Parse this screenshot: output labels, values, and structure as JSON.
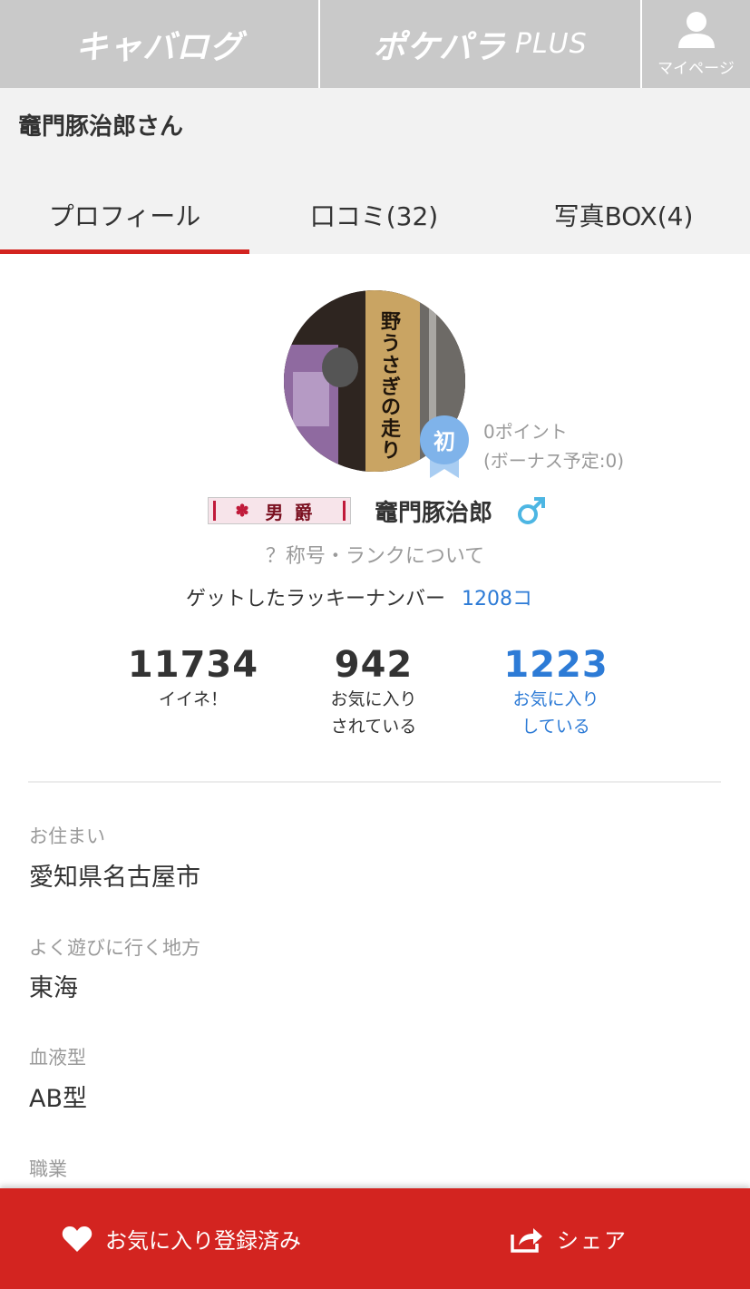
{
  "nav": {
    "logo1": "キャバログ",
    "logo2_main": "ポケパラ",
    "logo2_plus": "PLUS",
    "mypage": "マイページ"
  },
  "header": {
    "username": "竈門豚治郎さん",
    "tabs": [
      "プロフィール",
      "口コミ(32)",
      "写真BOX(4)"
    ],
    "active_tab_index": 0
  },
  "profile": {
    "avatar_label": "野うさぎの走り",
    "badge": "初",
    "points": "0ポイント",
    "bonus": "(ボーナス予定:0)",
    "rank": "男爵",
    "name": "竈門豚治郎",
    "gender_icon": "male-icon",
    "rank_link": "？称号・ランクについて",
    "lucky_label": "ゲットしたラッキーナンバー",
    "lucky_value": "1208コ"
  },
  "stats": [
    {
      "value": "11734",
      "label1": "イイネ！",
      "label2": ""
    },
    {
      "value": "942",
      "label1": "お気に入り",
      "label2": "されている"
    },
    {
      "value": "1223",
      "label1": "お気に入り",
      "label2": "している"
    }
  ],
  "fields": [
    {
      "label": "お住まい",
      "value": "愛知県名古屋市"
    },
    {
      "label": "よく遊びに行く地方",
      "value": "東海"
    },
    {
      "label": "血液型",
      "value": "AB型"
    },
    {
      "label": "職業",
      "value": ""
    }
  ],
  "bottom": {
    "favorite": "お気に入り登録済み",
    "share": "シェア"
  },
  "colors": {
    "accent_red": "#d32420",
    "link_blue": "#2d7bd6",
    "nav_gray": "#c9c9c9",
    "badge_blue": "#7fb3ea"
  }
}
